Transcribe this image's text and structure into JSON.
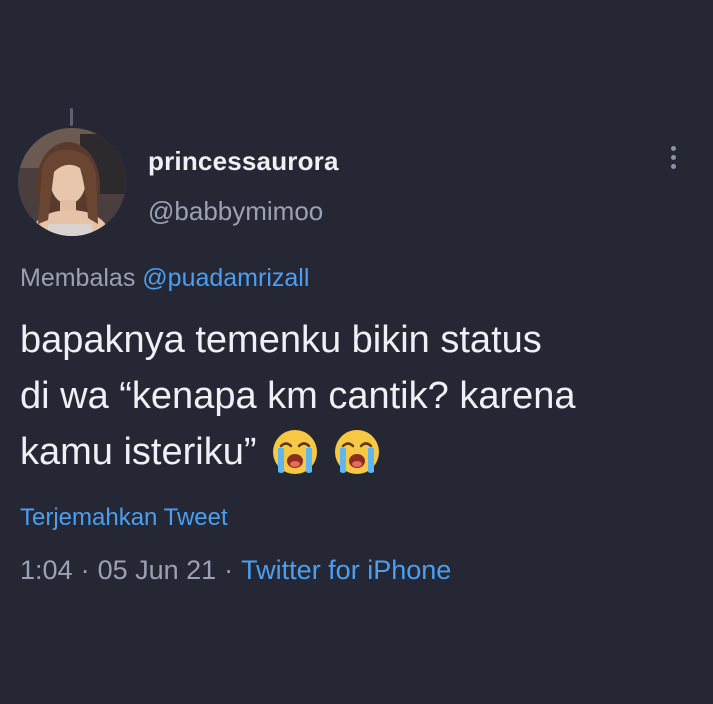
{
  "tweet": {
    "display_name": "princessaurora",
    "username": "@babbymimoo",
    "reply_prefix": "Membalas",
    "reply_to": "@puadamrizall",
    "text_lines": [
      "bapaknya temenku bikin status",
      "di wa “kenapa km cantik? karena",
      "kamu isteriku”"
    ],
    "emojis": [
      "loudly-crying-face",
      "loudly-crying-face"
    ],
    "translate_label": "Terjemahkan Tweet",
    "time": "1:04",
    "date": "05 Jun 21",
    "separator": "·",
    "source": "Twitter for iPhone"
  },
  "icons": {
    "more": "more-vertical-icon",
    "avatar": "profile-photo"
  },
  "colors": {
    "background": "#262735",
    "primary_text": "#eef0f4",
    "secondary_text": "#9aa1b2",
    "link": "#4a9ff0"
  }
}
